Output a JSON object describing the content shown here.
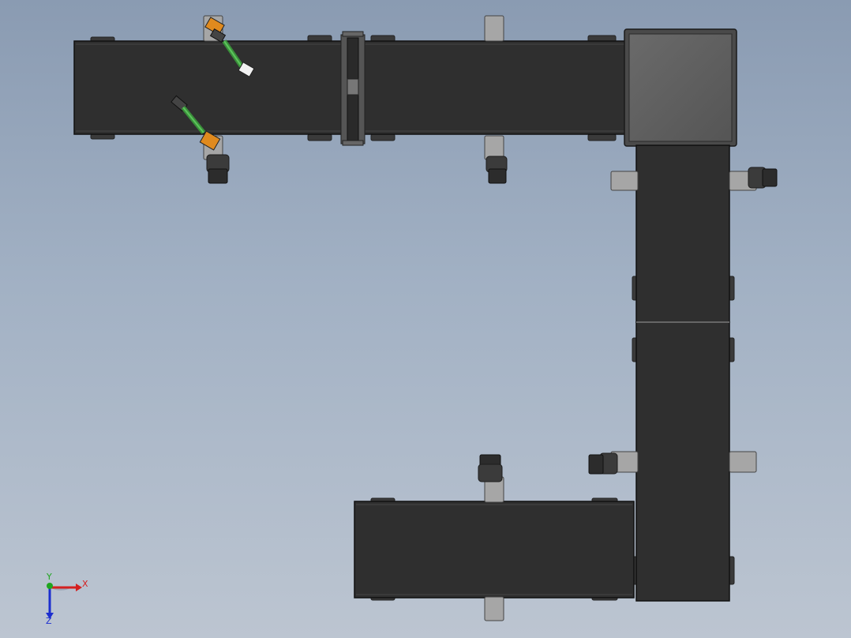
{
  "viewport": {
    "background_top": "#8a9bb2",
    "background_bottom": "#bcc5d1",
    "belt_color": "#2f2f2f",
    "frame_color": "#4a4a4a",
    "hood_color": "#5d5d5d",
    "bracket_color": "#a6a6a6",
    "cable_color": "#4caf50",
    "gripper_color": "#e08a1e"
  },
  "triad": {
    "x_label": "X",
    "y_label": "Y",
    "z_label": "Z",
    "x_color": "#d42020",
    "y_color": "#1fa51f",
    "z_color": "#1c2ecf"
  },
  "icons": [
    "coordinate-triad-icon"
  ]
}
